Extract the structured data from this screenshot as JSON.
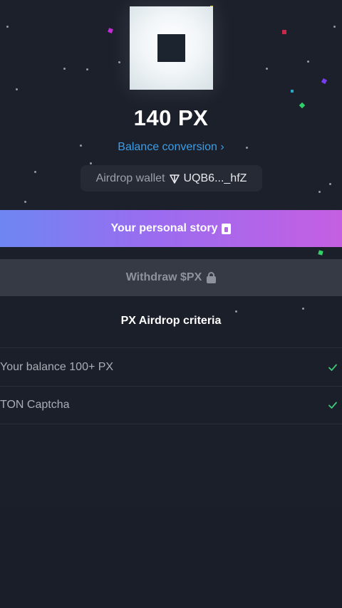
{
  "balance": {
    "amount": "140 PX"
  },
  "conversion": {
    "label": "Balance conversion ›"
  },
  "wallet": {
    "label": "Airdrop wallet",
    "address": "UQB6..._hfZ"
  },
  "story_button": {
    "label": "Your personal story"
  },
  "withdraw_button": {
    "label": "Withdraw $PX"
  },
  "criteria": {
    "title": "PX Airdrop criteria",
    "items": [
      {
        "label": "Your balance 100+ PX",
        "status": "met"
      },
      {
        "label": "TON Captcha",
        "status": "met"
      }
    ]
  },
  "colors": {
    "accent_link": "#3d9ee8",
    "check": "#3ec97a",
    "gradient_start": "#6e86f2",
    "gradient_end": "#c55fe2"
  },
  "icons": [
    "ton-icon",
    "story-icon",
    "lock-icon",
    "check-icon"
  ]
}
